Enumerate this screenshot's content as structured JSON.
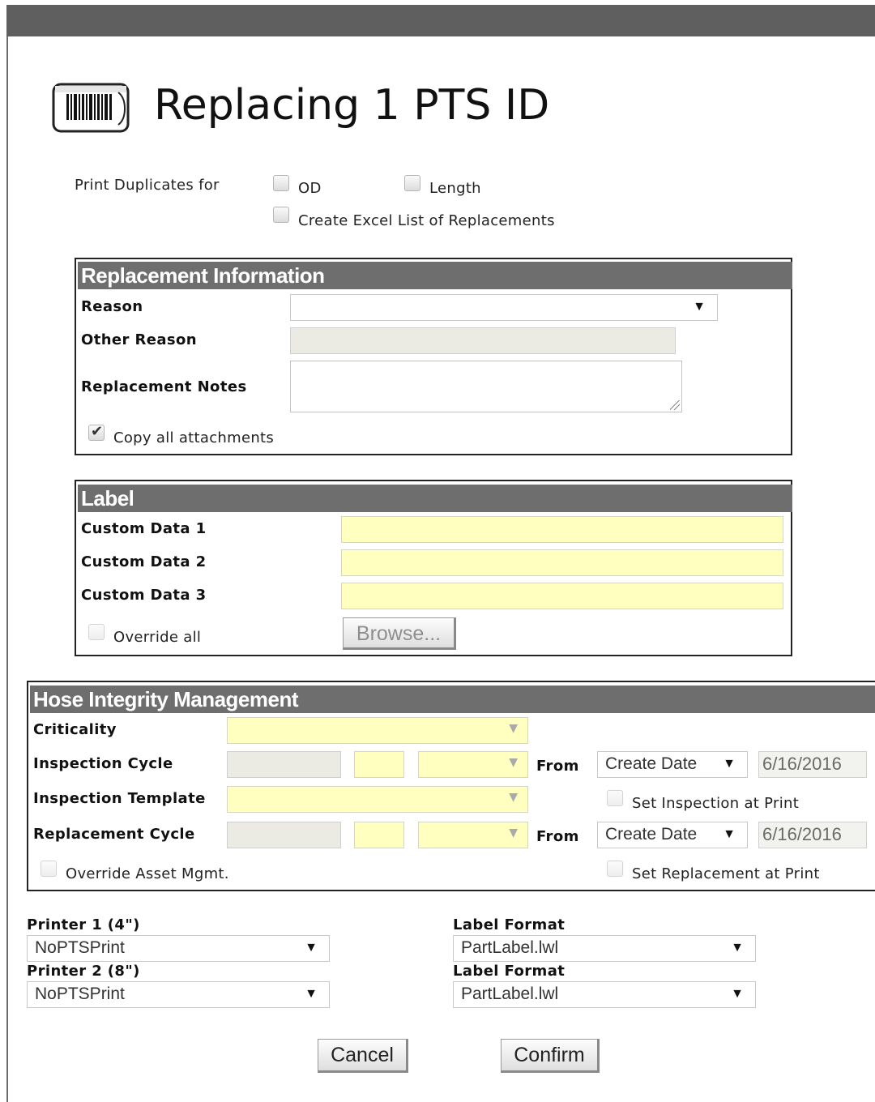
{
  "title": "Replacing 1 PTS ID",
  "duplicates": {
    "label": "Print Duplicates for",
    "od_label": "OD",
    "length_label": "Length",
    "excel_label": "Create Excel List of Replacements"
  },
  "replacement_info": {
    "heading": "Replacement Information",
    "reason_label": "Reason",
    "reason_value": "",
    "other_reason_label": "Other Reason",
    "notes_label": "Replacement Notes",
    "copy_attachments_label": "Copy all attachments",
    "copy_attachments_checked": true
  },
  "label_panel": {
    "heading": "Label",
    "custom1_label": "Custom Data 1",
    "custom2_label": "Custom Data 2",
    "custom3_label": "Custom Data 3",
    "override_all_label": "Override all",
    "browse_label": "Browse..."
  },
  "him": {
    "heading": "Hose Integrity Management",
    "criticality_label": "Criticality",
    "inspection_cycle_label": "Inspection Cycle",
    "inspection_template_label": "Inspection Template",
    "replacement_cycle_label": "Replacement Cycle",
    "from_label": "From",
    "inspection_from_value": "Create Date",
    "inspection_date": "6/16/2016",
    "replacement_from_value": "Create Date",
    "replacement_date": "6/16/2016",
    "set_inspection_label": "Set Inspection at Print",
    "set_replacement_label": "Set Replacement at Print",
    "override_asset_label": "Override Asset Mgmt."
  },
  "printers": {
    "printer1_label": "Printer 1 (4\")",
    "printer1_value": "NoPTSPrint",
    "printer2_label": "Printer 2 (8\")",
    "printer2_value": "NoPTSPrint",
    "format1_label": "Label Format",
    "format1_value": "PartLabel.lwl",
    "format2_label": "Label Format",
    "format2_value": "PartLabel.lwl"
  },
  "buttons": {
    "cancel": "Cancel",
    "confirm": "Confirm"
  },
  "icons": {
    "title_icon": "barcode-icon",
    "dropdown": "chevron-down-icon"
  },
  "colors": {
    "header_bar": "#5f5f5f",
    "panel_heading": "#6e6e6e",
    "required_field": "#ffffc0",
    "disabled_field": "#ebebe4"
  }
}
